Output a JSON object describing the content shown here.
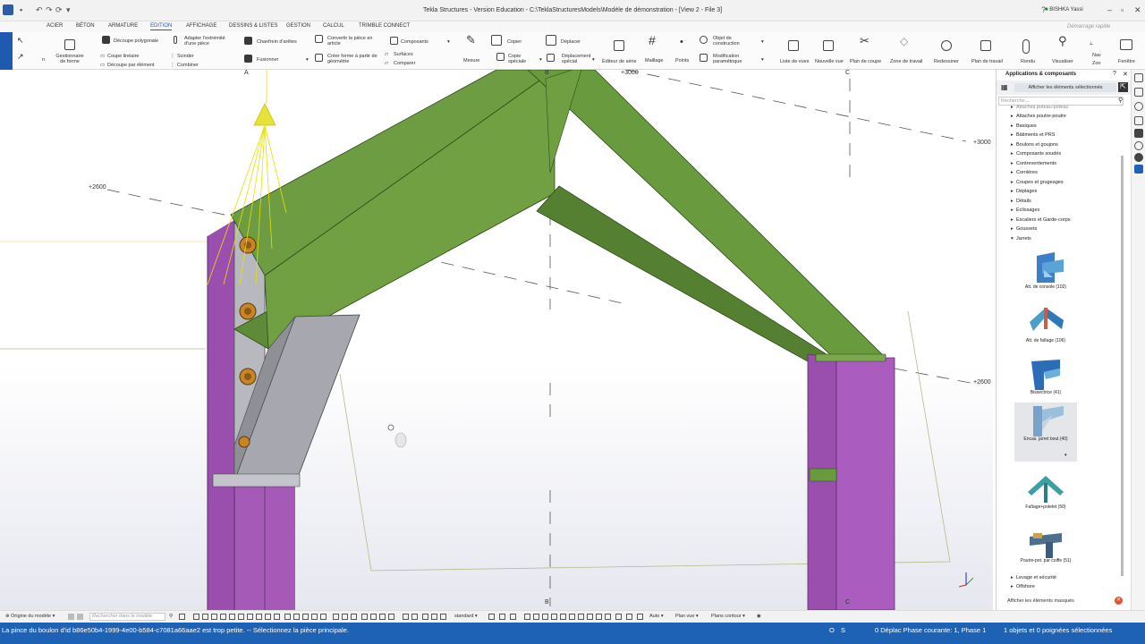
{
  "titlebar": {
    "title": "Tekla Structures - Version Education - C:\\TeklaStructuresModels\\Modèle de démonstration - [View 2 - File 3]",
    "user": "BISHKA Yassi"
  },
  "menu": {
    "tabs": [
      "ACIER",
      "BÉTON",
      "ARMATURE",
      "EDITION",
      "AFFICHAGE",
      "DESSINS & LISTES",
      "GESTION",
      "CALCUL",
      "TRIMBLE CONNECT"
    ],
    "active_tab": "EDITION",
    "quick_launch": "Démarrage rapide"
  },
  "ribbon": {
    "gestionnaire": "Gestionnaire de forme",
    "decoupe_polygonale": "Découpe polygonale",
    "adapter": "Adapter l'extrémité d'une pièce",
    "chanfrein": "Chanfrein d'arêtes",
    "convertir": "Convertir la pièce en article",
    "composants": "Composants",
    "copier": "Copier",
    "deplacer": "Déplacer",
    "objet_construction": "Objet de construction",
    "coupe_lineaire": "Coupe linéaire",
    "decoupe_element": "Découpe par élément",
    "scinder": "Scinder",
    "combiner": "Combiner",
    "fusionner": "Fusionner",
    "creer_forme": "Créer forme à partir de géométrie",
    "surfaces": "Surfaces",
    "comparer": "Comparer",
    "mesure": "Mesure",
    "copie_speciale": "Copie spéciale",
    "deplacement_special": "Déplacement spécial",
    "editeur_serie": "Éditeur de série",
    "maillage": "Maillage",
    "points": "Points",
    "modification_parametrique": "Modification paramétrique",
    "liste_vues": "Liste de vues",
    "nouvelle_vue": "Nouvelle vue",
    "plan_coupe": "Plan de coupe",
    "zone_travail": "Zone de travail",
    "redessiner": "Redessiner",
    "plan_travail": "Plan de travail",
    "rendu": "Rendu",
    "visualiser": "Visualiser",
    "nav": "Nav",
    "zoo": "Zoo",
    "fenetre": "Fenêtre"
  },
  "viewport": {
    "grid_labels": [
      "+3000",
      "+3000",
      "+2600",
      "+2600"
    ],
    "grid_letters": [
      "B",
      "C",
      "B",
      "C",
      "A"
    ]
  },
  "panel": {
    "title": "Applications & composants",
    "show_selected": "Afficher les éléments sélectionnés",
    "search_placeholder": "Recherche...",
    "tree": [
      "Attaches poteau-poteau",
      "Attaches poutre-poutre",
      "Basiques",
      "Bâtiments et PRS",
      "Boulons et goujons",
      "Composants soudés",
      "Contreventements",
      "Cornières",
      "Coupes et grugeages",
      "Déplages",
      "Détails",
      "Éclissages",
      "Escaliers et Garde-corps",
      "Goussets",
      "Jarrets"
    ],
    "components": [
      "Att. de console (102)",
      "Att. de faîtage (106)",
      "Bissectrice (41)",
      "Encas. jarret boul.(40)",
      "Faîtage+potelet (50)",
      "Poutre-pot. par coiffe (51)"
    ],
    "tree_bottom": [
      "Levage et sécurité",
      "Offshore"
    ],
    "footer": "Afficher les éléments masqués"
  },
  "bottombar": {
    "origin": "Origine du modèle",
    "search_placeholder": "Rechercher dans le modèle",
    "standard": "standard",
    "auto": "Auto",
    "plan_vue": "Plan vue",
    "plans_contour": "Plans contour"
  },
  "status": {
    "message": "La pince du boulon d'id b86e50b4-1999-4e00-b584-c7081a66aae2 est trop petite. -- Sélectionnez la pièce principale.",
    "o": "O",
    "s": "S",
    "phase": "0 Déplac Phase courante: 1, Phase 1",
    "selection": "1 objets et 0 poignées sélectionnées"
  },
  "colors": {
    "accent": "#1e62b5",
    "beam_green": "#6a9a3e",
    "column_purple": "#a157b5",
    "haunch_gray": "#a9aab0",
    "bolt_orange": "#d58a2a"
  }
}
